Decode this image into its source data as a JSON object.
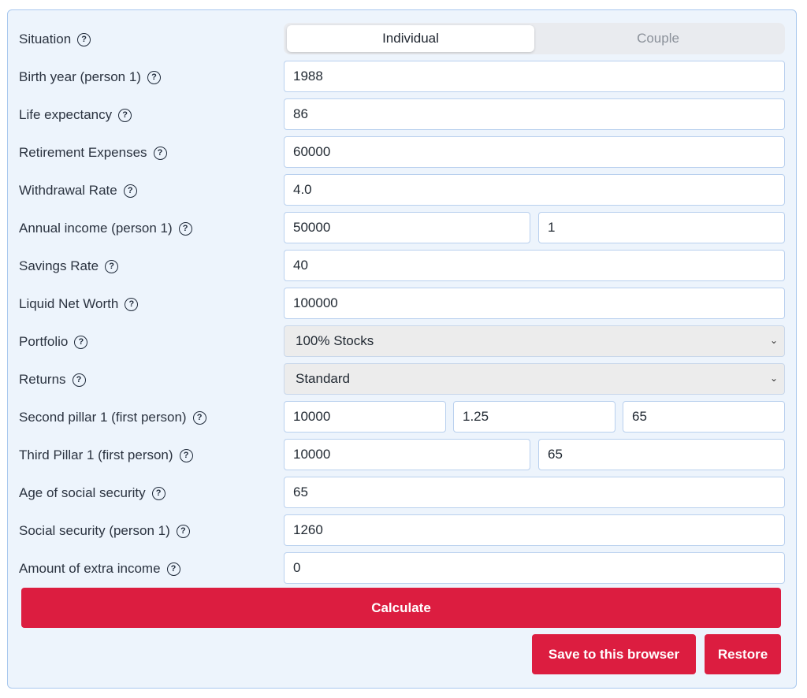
{
  "situation": {
    "label": "Situation",
    "options": [
      "Individual",
      "Couple"
    ],
    "selected": "Individual"
  },
  "fields": [
    {
      "label": "Birth year (person 1)",
      "values": [
        "1988"
      ]
    },
    {
      "label": "Life expectancy",
      "values": [
        "86"
      ]
    },
    {
      "label": "Retirement Expenses",
      "values": [
        "60000"
      ]
    },
    {
      "label": "Withdrawal Rate",
      "values": [
        "4.0"
      ]
    },
    {
      "label": "Annual income (person 1)",
      "values": [
        "50000",
        "1"
      ]
    },
    {
      "label": "Savings Rate",
      "values": [
        "40"
      ]
    },
    {
      "label": "Liquid Net Worth",
      "values": [
        "100000"
      ]
    },
    {
      "label": "Portfolio",
      "values": [
        "100% Stocks"
      ]
    },
    {
      "label": "Returns",
      "values": [
        "Standard"
      ]
    },
    {
      "label": "Second pillar 1 (first person)",
      "values": [
        "10000",
        "1.25",
        "65"
      ]
    },
    {
      "label": "Third Pillar 1 (first person)",
      "values": [
        "10000",
        "65"
      ]
    },
    {
      "label": "Age of social security",
      "values": [
        "65"
      ]
    },
    {
      "label": "Social security (person 1)",
      "values": [
        "1260"
      ]
    },
    {
      "label": "Amount of extra income",
      "values": [
        "0"
      ]
    }
  ],
  "help_glyph": "?",
  "select_chevron": "⌄",
  "buttons": {
    "calculate": "Calculate",
    "save": "Save to this browser",
    "restore": "Restore"
  },
  "colors": {
    "accent": "#dc1d40",
    "panel_bg": "#edf4fc",
    "panel_border": "#a9c8ee"
  }
}
